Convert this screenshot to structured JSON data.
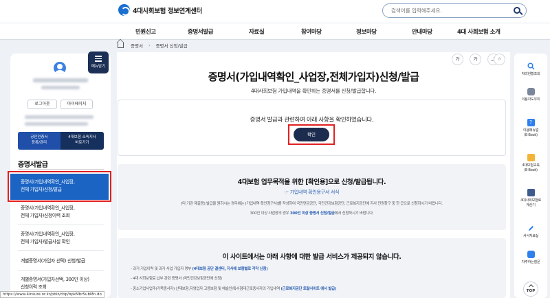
{
  "header": {
    "logo_text": "4대사회보험 정보연계센터",
    "search_placeholder": "검색어를 입력해주세요."
  },
  "gnb": [
    "민원신고",
    "증명서발급",
    "자료실",
    "참여마당",
    "정보마당",
    "안내마당",
    "4대 사회보험 소개"
  ],
  "breadcrumb": [
    "증명서",
    "증명서 신청/발급"
  ],
  "sidebar": {
    "menu_button": "메뉴닫기",
    "buttons": {
      "logout": "로그아웃",
      "mypage": "마이페이지"
    },
    "cert": {
      "left": [
        "공인인증서",
        "등록/관리"
      ],
      "right": [
        "4대보험 소속지사",
        "바로가기"
      ]
    },
    "section_title": "증명서발급",
    "active_item": [
      "증명서(가입내역확인_사업장,",
      "전체 가입자)신청/발급"
    ],
    "items": [
      [
        "증명서(가입내역확인_사업장,",
        "전체 가입자)신청이력 조회"
      ],
      [
        "증명서(가입내역확인_사업장,",
        "전체 가입자)발급사실 확인"
      ],
      [
        "개별증명서(가입자 선택) 신청/발급"
      ],
      [
        "개별증명서(가입자선택, 300인 이상)",
        "신청이력 조회"
      ]
    ]
  },
  "tools": [
    "가",
    "가",
    "share",
    "star"
  ],
  "main": {
    "title": "증명서(가입내역확인_사업장,전체가입자)신청/발급",
    "subtitle": "4대사회보험 가입내역을 확인하는 증명서를 신청/발급합니다.",
    "box1_text": "증명서 발급과 관련하여 아래 사항을 확인하였습니다.",
    "confirm_button": "확인",
    "box2": {
      "title": "4대보험 업무목적을 위한 [확인용]으로 신청/발급됩니다.",
      "link": "☞ 가입내역 확인용구서 서식",
      "desc1": "[타 기관 제출용] 발급을 원하시는 경우에는 [가입내역 확인청구서]를 작성하여 국민연금공단, 국민건강보험공단, 근로복지공단에 지사 민원창구 중 한 곳으로 신청하시기 바랍니다.",
      "desc2_pre": "300인 이상 사업장의 경우 ",
      "desc2_hl": "300인 이상 증명서 신청/발급",
      "desc2_post": "에서 신청하시기 바랍니다."
    },
    "box3": {
      "title": "이 사이트에서는 아래 사항에 대한 발급 서비스가 제공되지 않습니다.",
      "item1_pre": "- 과거 가입이력 및 과거 사업 가입자 명부 ",
      "item1_hl": "(4대보험 공단 결센터, 지사에 보험별로 각각 신청)",
      "item2": "- 4대 사회보험료 납부 관련 증명서 (국민건강보험공단에 신청)",
      "item3_pre": "- 중소기업사업주(가족종사자) 산재보험,자영업자 고용보험 및 예술인/특수형태근로종사자의 가입내역 ",
      "item3_hl": "(근로복지공단 토탈사이트 에서 발급)"
    }
  },
  "quick_menu": [
    {
      "icon": "search-icon",
      "label": [
        "처리현황조회"
      ],
      "color": "#2f80ed"
    },
    {
      "icon": "chat-icon",
      "label": [
        "이용자도우미"
      ],
      "color": "#7a8699"
    },
    {
      "icon": "help-icon",
      "label": [
        "이용매뉴얼",
        "(E-Book)"
      ],
      "color": "#2f80ed"
    },
    {
      "icon": "book-icon",
      "label": [
        "4대보험교육",
        "(E-Book)"
      ],
      "color": "#f2b53a"
    },
    {
      "icon": "calculator-icon",
      "label": [
        "4대사회보험료",
        "계산기"
      ],
      "color": "#3f5b8c"
    },
    {
      "icon": "pencil-icon",
      "label": [
        "서식자료실"
      ],
      "color": "#2f80ed"
    },
    {
      "icon": "faq-icon",
      "label": [
        "자주하는질문"
      ],
      "color": "#2f80ed"
    }
  ],
  "top_button": "TOP",
  "status_url": "https://www.4insure.or.kr/pbiz/cbp/bpkMbrSubMn.do"
}
